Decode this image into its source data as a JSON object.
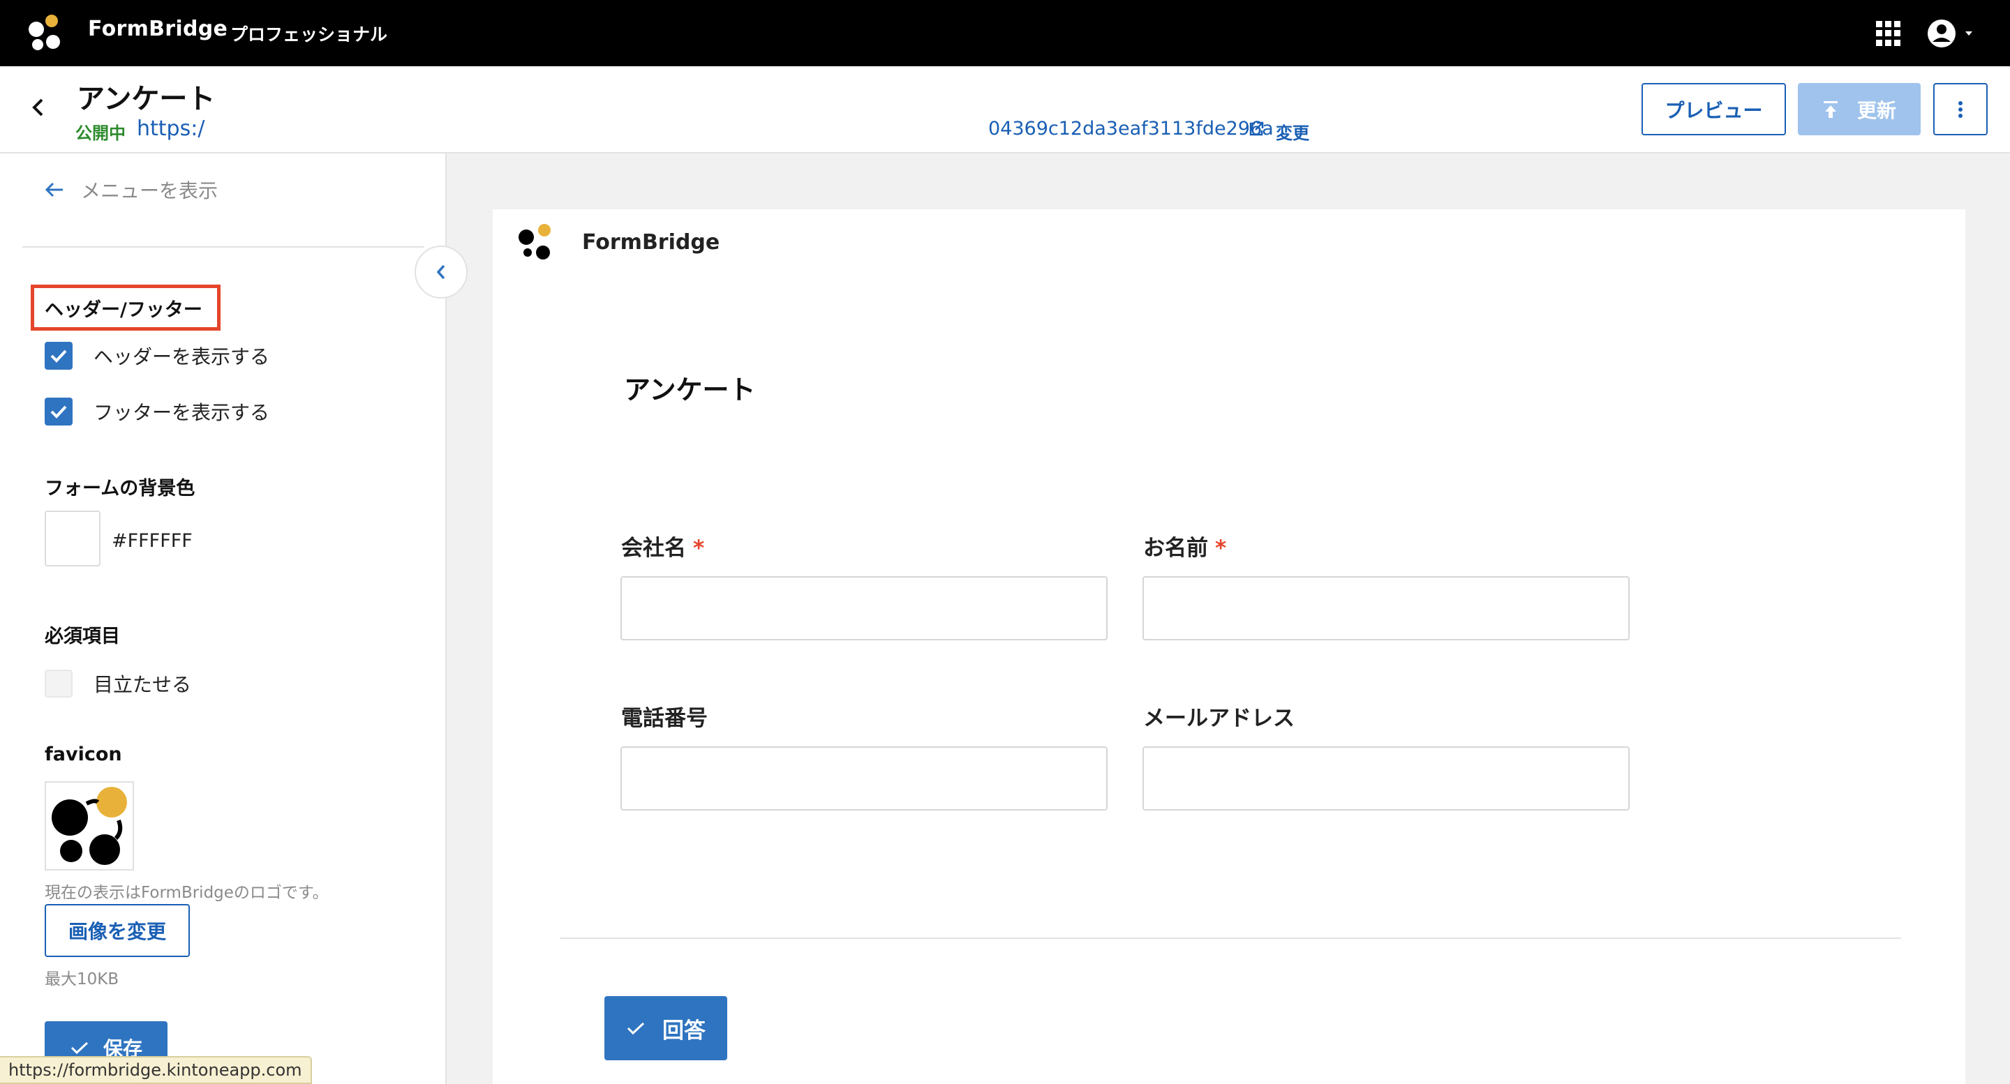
{
  "app": {
    "brand": "FormBridge",
    "edition": "プロフェッショナル"
  },
  "icons": {
    "logo": "formbridge-logo-icon",
    "apps": "grid-apps-icon",
    "account": "account-circle-icon",
    "back": "chevron-left-icon",
    "external": "external-link-icon",
    "more": "more-vertical-icon",
    "upload": "upload-icon",
    "check": "check-icon",
    "arrow_left": "arrow-left-icon"
  },
  "colors": {
    "accent": "#2F74C0",
    "link": "#1A5FB4",
    "status_public": "#2E8B2E",
    "required": "#E4452B",
    "highlight": "#E4452B",
    "logo_yellow": "#E8B23A"
  },
  "header": {
    "title": "アンケート",
    "status": "公開中",
    "url_start": "https:/",
    "url_end": "04369c12da3eaf3113fde296a",
    "change_link": "変更",
    "preview_button": "プレビュー",
    "update_button": "更新"
  },
  "sidebar": {
    "show_menu": "メニューを表示",
    "header_footer": {
      "title": "ヘッダー/フッター",
      "show_header": {
        "label": "ヘッダーを表示する",
        "checked": true
      },
      "show_footer": {
        "label": "フッターを表示する",
        "checked": true
      }
    },
    "background": {
      "title": "フォームの背景色",
      "value": "#FFFFFF"
    },
    "required": {
      "title": "必須項目",
      "emphasize": {
        "label": "目立たせる",
        "checked": false
      }
    },
    "favicon": {
      "title": "favicon",
      "note": "現在の表示はFormBridgeのロゴです。",
      "change_button": "画像を変更",
      "max_size": "最大10KB"
    },
    "save_button": "保存"
  },
  "status_bar": {
    "url": "https://formbridge.kintoneapp.com"
  },
  "preview": {
    "brand": "FormBridge",
    "title": "アンケート",
    "fields": [
      {
        "label": "会社名",
        "required": true,
        "value": ""
      },
      {
        "label": "お名前",
        "required": true,
        "value": ""
      },
      {
        "label": "電話番号",
        "required": false,
        "value": ""
      },
      {
        "label": "メールアドレス",
        "required": false,
        "value": ""
      }
    ],
    "required_mark": "*",
    "submit_button": "回答"
  }
}
